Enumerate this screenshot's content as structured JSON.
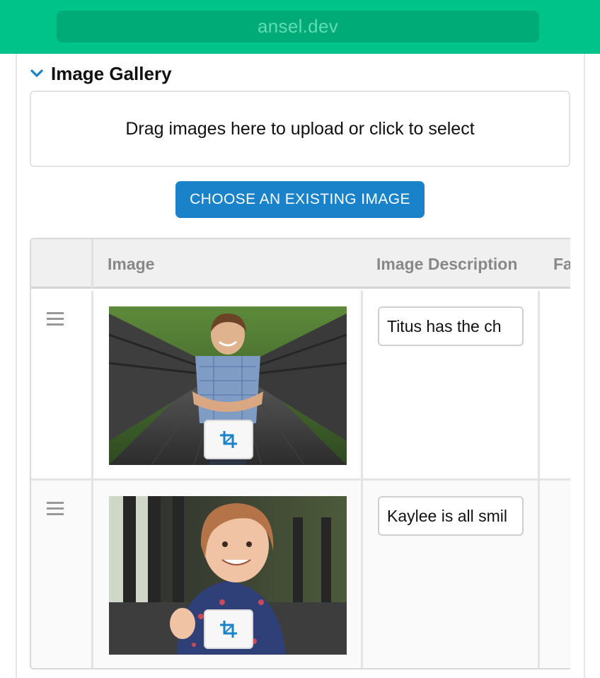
{
  "browser": {
    "url": "ansel.dev"
  },
  "section": {
    "title": "Image Gallery"
  },
  "upload": {
    "dropzone_text": "Drag images here to upload or click to select",
    "choose_button": "CHOOSE AN EXISTING IMAGE"
  },
  "table": {
    "columns": [
      "Image",
      "Image Description",
      "Fa"
    ],
    "rows": [
      {
        "description": "Titus has the ch"
      },
      {
        "description": "Kaylee is all smil"
      }
    ]
  },
  "colors": {
    "topbar": "#00c389",
    "accent": "#1a82c8"
  },
  "icons": [
    "chevron-down-icon",
    "drag-handle-icon",
    "crop-icon"
  ]
}
